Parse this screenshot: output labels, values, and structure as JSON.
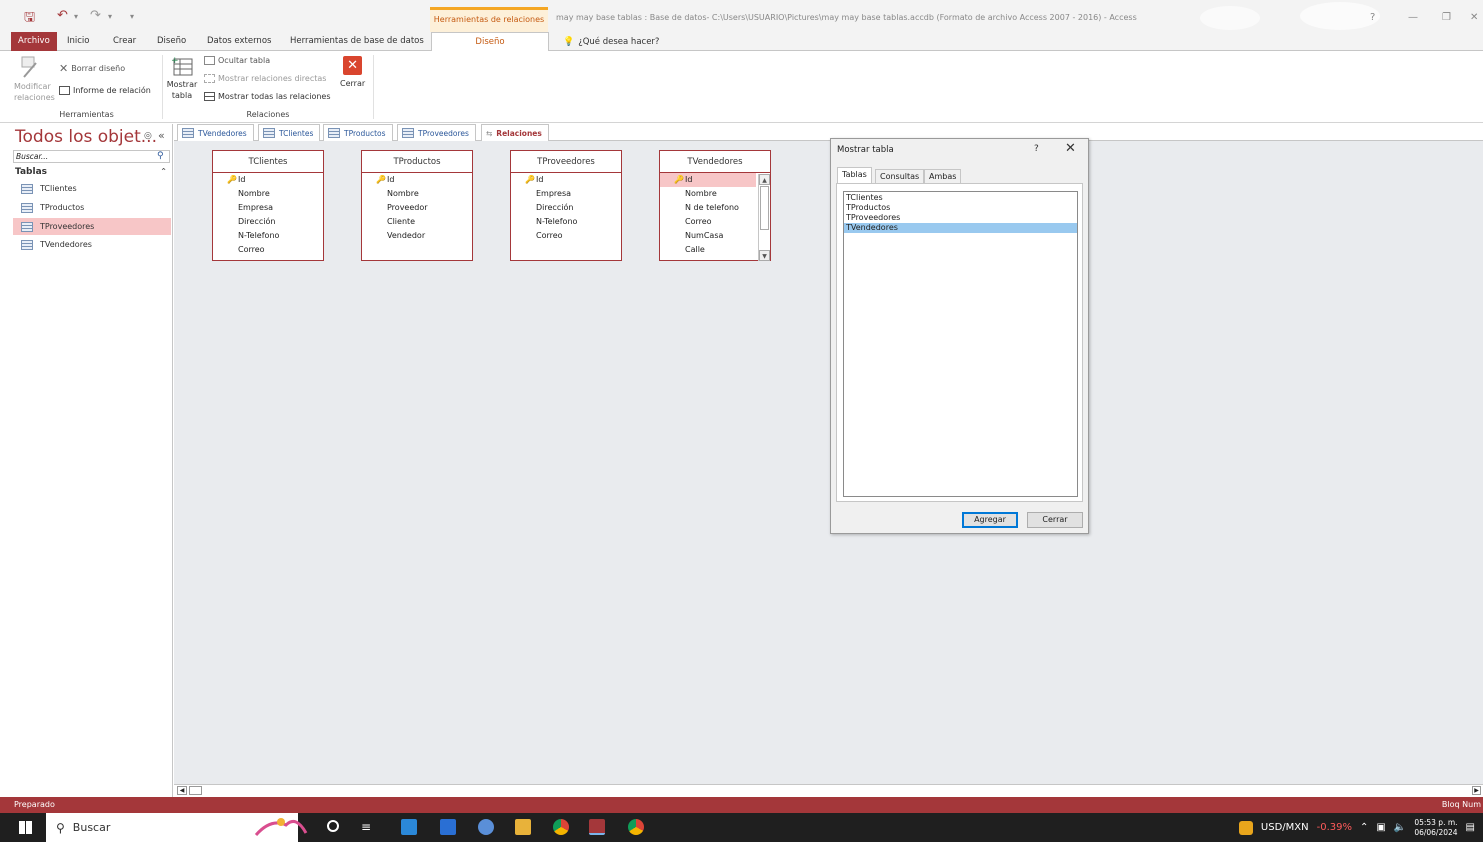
{
  "colors": {
    "accent": "#a4373a",
    "context_orange": "#c55a11",
    "selection": "#f7c6c7",
    "list_selection": "#99c9ef"
  },
  "titlebar": {
    "context_tab": "Herramientas de relaciones",
    "document_title": "may may base tablas : Base de datos- C:\\Users\\USUARIO\\Pictures\\may may base tablas.accdb (Formato de archivo Access 2007 - 2016) - Access",
    "help": "?"
  },
  "tabs": [
    "Archivo",
    "Inicio",
    "Crear",
    "Diseño",
    "Datos externos",
    "Herramientas de base de datos",
    "Diseño"
  ],
  "tell_me": "¿Qué desea hacer?",
  "ribbon": {
    "herramientas": {
      "label": "Herramientas",
      "modificar": "Modificar relaciones",
      "borrar": "Borrar diseño",
      "informe": "Informe de relación"
    },
    "relaciones": {
      "label": "Relaciones",
      "mostrar_tabla": "Mostrar tabla",
      "ocultar": "Ocultar tabla",
      "directas": "Mostrar relaciones directas",
      "todas": "Mostrar todas las relaciones",
      "cerrar": "Cerrar"
    }
  },
  "nav": {
    "title": "Todos los objet...",
    "search_placeholder": "Buscar...",
    "section": "Tablas",
    "items": [
      "TClientes",
      "TProductos",
      "TProveedores",
      "TVendedores"
    ],
    "selected_index": 2
  },
  "doc_tabs": [
    "TVendedores",
    "TClientes",
    "TProductos",
    "TProveedores",
    "Relaciones"
  ],
  "tables": [
    {
      "name": "TClientes",
      "fields": [
        "Id",
        "Nombre",
        "Empresa",
        "Dirección",
        "N-Telefono",
        "Correo"
      ]
    },
    {
      "name": "TProductos",
      "fields": [
        "Id",
        "Nombre",
        "Proveedor",
        "Cliente",
        "Vendedor"
      ]
    },
    {
      "name": "TProveedores",
      "fields": [
        "Id",
        "Empresa",
        "Dirección",
        "N-Telefono",
        "Correo"
      ]
    },
    {
      "name": "TVendedores",
      "fields": [
        "Id",
        "Nombre",
        "N de telefono",
        "Correo",
        "NumCasa",
        "Calle"
      ]
    }
  ],
  "dialog": {
    "title": "Mostrar tabla",
    "help": "?",
    "tabs": [
      "Tablas",
      "Consultas",
      "Ambas"
    ],
    "items": [
      "TClientes",
      "TProductos",
      "TProveedores",
      "TVendedores"
    ],
    "selected_index": 3,
    "add_button": "Agregar",
    "close_button": "Cerrar"
  },
  "status": {
    "left": "Preparado",
    "right": "Bloq Num"
  },
  "taskbar": {
    "search": "Buscar",
    "currency": "USD/MXN",
    "change": "-0.39%",
    "time": "05:53 p. m.",
    "date": "06/06/2024"
  }
}
